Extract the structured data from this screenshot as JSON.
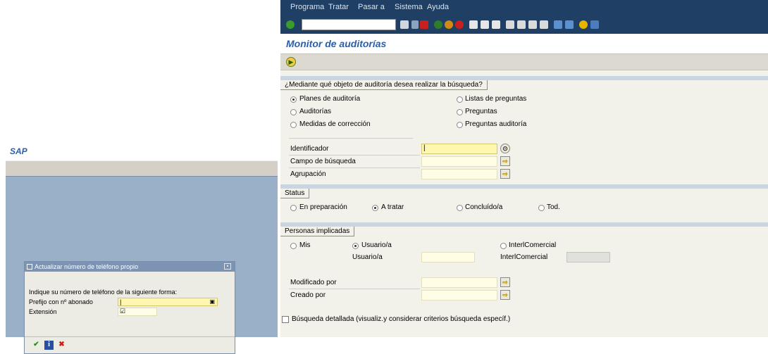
{
  "left": {
    "title": "SAP",
    "dialog": {
      "title": "Actualizar número de teléfono propio",
      "instruction": "Indique su número de teléfono de la siguiente forma:",
      "prefix_label": "Prefijo con nº abonado",
      "extension_label": "Extensión",
      "buttons": {
        "ok": "✔",
        "info": "i",
        "cancel": "✖"
      }
    }
  },
  "right": {
    "menu": [
      "Programa",
      "Tratar",
      "Pasar a",
      "Sistema",
      "Ayuda"
    ],
    "title": "Monitor de auditorías",
    "search_object": {
      "title": "¿Mediante qué objeto de auditoría desea realizar la búsqueda?",
      "options": [
        "Planes de auditoría",
        "Listas de preguntas",
        "Auditorías",
        "Preguntas",
        "Medidas de corrección",
        "Preguntas auditoría"
      ],
      "selected": "Planes de auditoría",
      "fields": {
        "identificador": "Identificador",
        "campo": "Campo de búsqueda",
        "agrupacion": "Agrupación"
      }
    },
    "status": {
      "title": "Status",
      "options": [
        "En preparación",
        "A tratar",
        "Concluído/a",
        "Tod."
      ],
      "selected": "A tratar"
    },
    "personas": {
      "title": "Personas implicadas",
      "options": [
        "Mis",
        "Usuario/a",
        "InterlComercial"
      ],
      "selected": "Usuario/a",
      "usuario_label": "Usuario/a",
      "interl_label": "InterlComercial",
      "modificado": "Modificado por",
      "creado": "Creado por"
    },
    "detailed": "Búsqueda detallada (visualiz.y considerar criterios búsqueda específ.)"
  }
}
